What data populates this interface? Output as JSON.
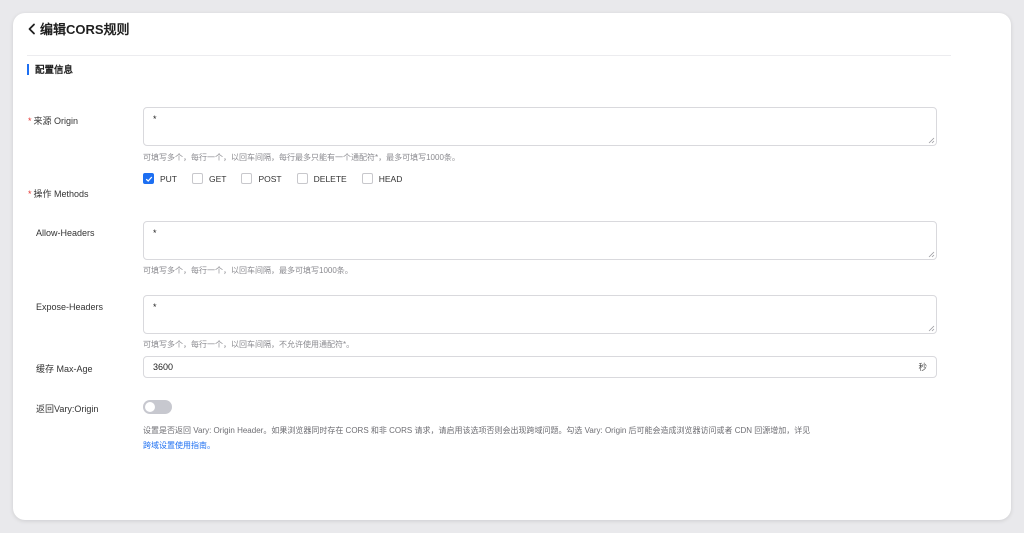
{
  "header": {
    "title": "编辑CORS规则"
  },
  "section": {
    "title": "配置信息"
  },
  "origin": {
    "label": "来源 Origin",
    "value": "*",
    "hint": "可填写多个，每行一个，以回车间隔，每行最多只能有一个通配符*，最多可填写1000条。"
  },
  "methods": {
    "label": "操作 Methods",
    "options": [
      {
        "label": "PUT",
        "checked": true
      },
      {
        "label": "GET",
        "checked": false
      },
      {
        "label": "POST",
        "checked": false
      },
      {
        "label": "DELETE",
        "checked": false
      },
      {
        "label": "HEAD",
        "checked": false
      }
    ]
  },
  "allow_headers": {
    "label": "Allow-Headers",
    "value": "*",
    "hint": "可填写多个，每行一个，以回车间隔，最多可填写1000条。"
  },
  "expose_headers": {
    "label": "Expose-Headers",
    "value": "*",
    "hint": "可填写多个，每行一个，以回车间隔，不允许使用通配符*。"
  },
  "max_age": {
    "label": "缓存 Max-Age",
    "value": "3600",
    "unit": "秒"
  },
  "vary": {
    "label": "返回Vary:Origin",
    "enabled": false,
    "desc": "设置是否返回 Vary: Origin Header。如果浏览器同时存在 CORS 和非 CORS 请求，请启用该选项否则会出现跨域问题。勾选 Vary: Origin 后可能会造成浏览器访问或者 CDN 回源增加，详见",
    "link": "跨域设置使用指南。"
  },
  "colors": {
    "accent": "#1d6ff2",
    "required": "#e53935",
    "hint": "#8a8a8f"
  }
}
